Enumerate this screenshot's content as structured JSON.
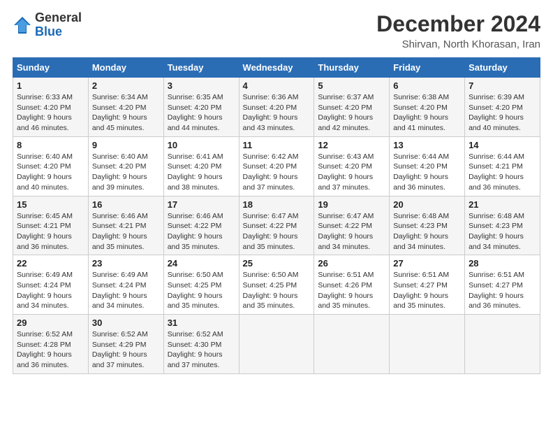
{
  "logo": {
    "general": "General",
    "blue": "Blue"
  },
  "title": "December 2024",
  "location": "Shirvan, North Khorasan, Iran",
  "headers": [
    "Sunday",
    "Monday",
    "Tuesday",
    "Wednesday",
    "Thursday",
    "Friday",
    "Saturday"
  ],
  "weeks": [
    [
      {
        "day": "1",
        "sunrise": "6:33 AM",
        "sunset": "4:20 PM",
        "daylight": "9 hours and 46 minutes."
      },
      {
        "day": "2",
        "sunrise": "6:34 AM",
        "sunset": "4:20 PM",
        "daylight": "9 hours and 45 minutes."
      },
      {
        "day": "3",
        "sunrise": "6:35 AM",
        "sunset": "4:20 PM",
        "daylight": "9 hours and 44 minutes."
      },
      {
        "day": "4",
        "sunrise": "6:36 AM",
        "sunset": "4:20 PM",
        "daylight": "9 hours and 43 minutes."
      },
      {
        "day": "5",
        "sunrise": "6:37 AM",
        "sunset": "4:20 PM",
        "daylight": "9 hours and 42 minutes."
      },
      {
        "day": "6",
        "sunrise": "6:38 AM",
        "sunset": "4:20 PM",
        "daylight": "9 hours and 41 minutes."
      },
      {
        "day": "7",
        "sunrise": "6:39 AM",
        "sunset": "4:20 PM",
        "daylight": "9 hours and 40 minutes."
      }
    ],
    [
      {
        "day": "8",
        "sunrise": "6:40 AM",
        "sunset": "4:20 PM",
        "daylight": "9 hours and 40 minutes."
      },
      {
        "day": "9",
        "sunrise": "6:40 AM",
        "sunset": "4:20 PM",
        "daylight": "9 hours and 39 minutes."
      },
      {
        "day": "10",
        "sunrise": "6:41 AM",
        "sunset": "4:20 PM",
        "daylight": "9 hours and 38 minutes."
      },
      {
        "day": "11",
        "sunrise": "6:42 AM",
        "sunset": "4:20 PM",
        "daylight": "9 hours and 37 minutes."
      },
      {
        "day": "12",
        "sunrise": "6:43 AM",
        "sunset": "4:20 PM",
        "daylight": "9 hours and 37 minutes."
      },
      {
        "day": "13",
        "sunrise": "6:44 AM",
        "sunset": "4:20 PM",
        "daylight": "9 hours and 36 minutes."
      },
      {
        "day": "14",
        "sunrise": "6:44 AM",
        "sunset": "4:21 PM",
        "daylight": "9 hours and 36 minutes."
      }
    ],
    [
      {
        "day": "15",
        "sunrise": "6:45 AM",
        "sunset": "4:21 PM",
        "daylight": "9 hours and 36 minutes."
      },
      {
        "day": "16",
        "sunrise": "6:46 AM",
        "sunset": "4:21 PM",
        "daylight": "9 hours and 35 minutes."
      },
      {
        "day": "17",
        "sunrise": "6:46 AM",
        "sunset": "4:22 PM",
        "daylight": "9 hours and 35 minutes."
      },
      {
        "day": "18",
        "sunrise": "6:47 AM",
        "sunset": "4:22 PM",
        "daylight": "9 hours and 35 minutes."
      },
      {
        "day": "19",
        "sunrise": "6:47 AM",
        "sunset": "4:22 PM",
        "daylight": "9 hours and 34 minutes."
      },
      {
        "day": "20",
        "sunrise": "6:48 AM",
        "sunset": "4:23 PM",
        "daylight": "9 hours and 34 minutes."
      },
      {
        "day": "21",
        "sunrise": "6:48 AM",
        "sunset": "4:23 PM",
        "daylight": "9 hours and 34 minutes."
      }
    ],
    [
      {
        "day": "22",
        "sunrise": "6:49 AM",
        "sunset": "4:24 PM",
        "daylight": "9 hours and 34 minutes."
      },
      {
        "day": "23",
        "sunrise": "6:49 AM",
        "sunset": "4:24 PM",
        "daylight": "9 hours and 34 minutes."
      },
      {
        "day": "24",
        "sunrise": "6:50 AM",
        "sunset": "4:25 PM",
        "daylight": "9 hours and 35 minutes."
      },
      {
        "day": "25",
        "sunrise": "6:50 AM",
        "sunset": "4:25 PM",
        "daylight": "9 hours and 35 minutes."
      },
      {
        "day": "26",
        "sunrise": "6:51 AM",
        "sunset": "4:26 PM",
        "daylight": "9 hours and 35 minutes."
      },
      {
        "day": "27",
        "sunrise": "6:51 AM",
        "sunset": "4:27 PM",
        "daylight": "9 hours and 35 minutes."
      },
      {
        "day": "28",
        "sunrise": "6:51 AM",
        "sunset": "4:27 PM",
        "daylight": "9 hours and 36 minutes."
      }
    ],
    [
      {
        "day": "29",
        "sunrise": "6:52 AM",
        "sunset": "4:28 PM",
        "daylight": "9 hours and 36 minutes."
      },
      {
        "day": "30",
        "sunrise": "6:52 AM",
        "sunset": "4:29 PM",
        "daylight": "9 hours and 37 minutes."
      },
      {
        "day": "31",
        "sunrise": "6:52 AM",
        "sunset": "4:30 PM",
        "daylight": "9 hours and 37 minutes."
      },
      null,
      null,
      null,
      null
    ]
  ]
}
